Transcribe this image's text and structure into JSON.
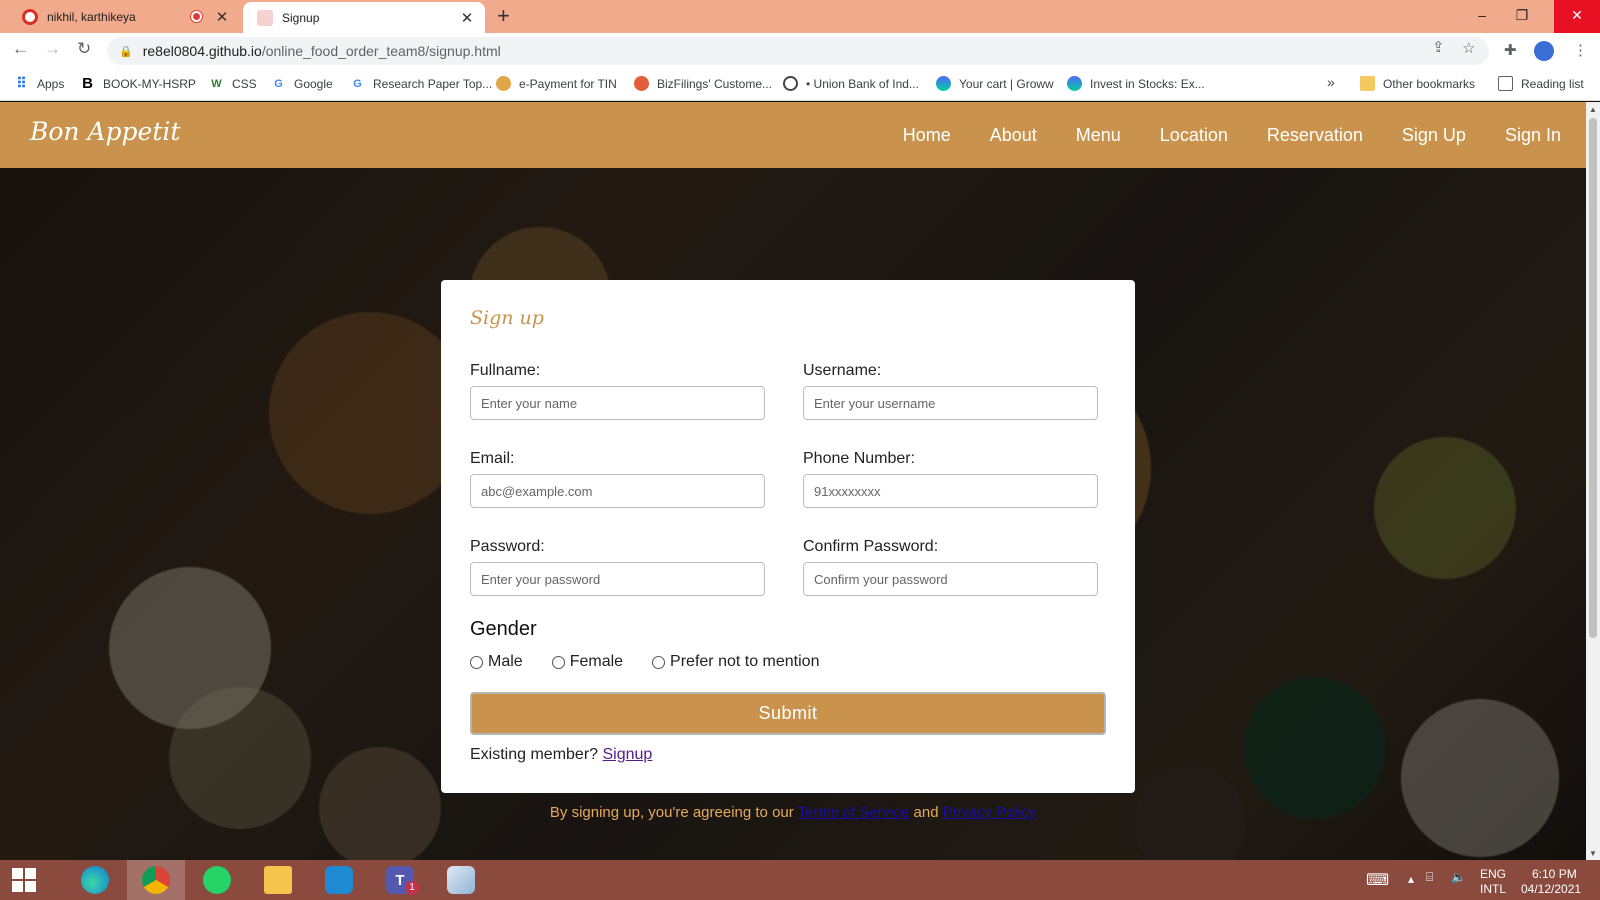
{
  "browser": {
    "tabs": [
      {
        "title": "nikhil, karthikeya"
      },
      {
        "title": "Signup"
      }
    ],
    "url_host": "re8el0804.github.io",
    "url_path": "/online_food_order_team8/signup.html",
    "bookmarks": [
      {
        "label": "Apps",
        "icon": "apps-grid-icon"
      },
      {
        "label": "BOOK-MY-HSRP",
        "icon": "b-icon"
      },
      {
        "label": "CSS",
        "icon": "w-icon"
      },
      {
        "label": "Google",
        "icon": "google-icon"
      },
      {
        "label": "Research Paper Top...",
        "icon": "google-icon"
      },
      {
        "label": "e-Payment for TIN",
        "icon": "nsdl-icon"
      },
      {
        "label": "BizFilings' Custome...",
        "icon": "globe-icon"
      },
      {
        "label": "• Union Bank of Ind...",
        "icon": "union-bank-icon"
      },
      {
        "label": "Your cart | Groww",
        "icon": "groww-icon"
      },
      {
        "label": "Invest in Stocks: Ex...",
        "icon": "groww-icon"
      }
    ],
    "overflow": "»",
    "other_bookmarks": "Other bookmarks",
    "reading_list": "Reading list"
  },
  "site": {
    "logo": "Bon Appetit",
    "nav": [
      "Home",
      "About",
      "Menu",
      "Location",
      "Reservation",
      "Sign Up",
      "Sign In"
    ]
  },
  "form": {
    "title": "Sign up",
    "fullname": {
      "label": "Fullname:",
      "placeholder": "Enter your name"
    },
    "username": {
      "label": "Username:",
      "placeholder": "Enter your username"
    },
    "email": {
      "label": "Email:",
      "placeholder": "abc@example.com"
    },
    "phone": {
      "label": "Phone Number:",
      "placeholder": "91xxxxxxxx"
    },
    "password": {
      "label": "Password:",
      "placeholder": "Enter your password"
    },
    "confirm": {
      "label": "Confirm Password:",
      "placeholder": "Confirm your password"
    },
    "gender_heading": "Gender",
    "gender_options": [
      "Male",
      "Female",
      "Prefer not to mention"
    ],
    "submit": "Submit",
    "existing_text": "Existing member?",
    "existing_link": "Signup"
  },
  "terms": {
    "prefix": "By signing up, you're agreeing to our",
    "tos": "Terms of Service",
    "and": "and",
    "privacy": "Privacy Policy"
  },
  "tray": {
    "lang_top": "ENG",
    "lang_bottom": "INTL",
    "time": "6:10 PM",
    "date": "04/12/2021",
    "teams_badge": "1"
  },
  "colors": {
    "brand": "#c9934d",
    "tabbar": "#f2aa8c",
    "taskbar": "#8a4a3e"
  }
}
